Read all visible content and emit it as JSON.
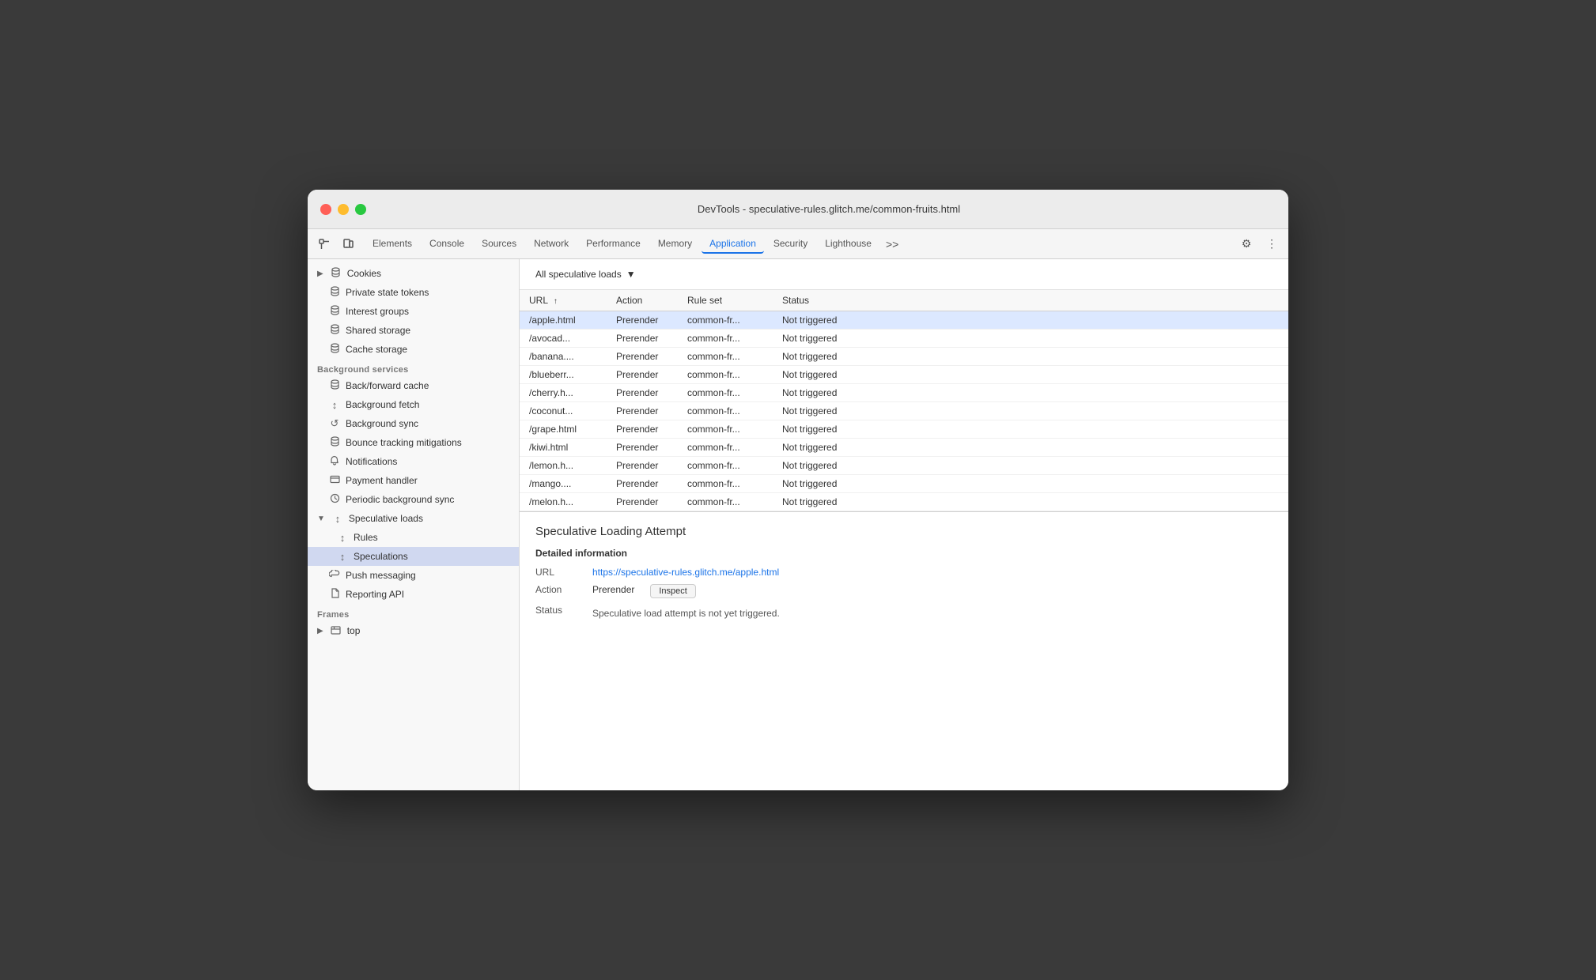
{
  "window": {
    "title": "DevTools - speculative-rules.glitch.me/common-fruits.html"
  },
  "tabs": {
    "items": [
      {
        "label": "Elements",
        "active": false
      },
      {
        "label": "Console",
        "active": false
      },
      {
        "label": "Sources",
        "active": false
      },
      {
        "label": "Network",
        "active": false
      },
      {
        "label": "Performance",
        "active": false
      },
      {
        "label": "Memory",
        "active": false
      },
      {
        "label": "Application",
        "active": true
      },
      {
        "label": "Security",
        "active": false
      },
      {
        "label": "Lighthouse",
        "active": false
      }
    ],
    "more_label": ">>",
    "settings_icon": "⚙",
    "kebab_icon": "⋮"
  },
  "sidebar": {
    "sections": [
      {
        "items": [
          {
            "label": "Cookies",
            "icon": "▶",
            "icon_type": "chevron",
            "has_db": true,
            "indent": 0
          },
          {
            "label": "Private state tokens",
            "icon": "",
            "has_db": true,
            "indent": 0
          },
          {
            "label": "Interest groups",
            "icon": "",
            "has_db": true,
            "indent": 0
          },
          {
            "label": "Shared storage",
            "icon": "",
            "has_db": true,
            "indent": 0
          },
          {
            "label": "Cache storage",
            "icon": "",
            "has_db": true,
            "indent": 0
          }
        ]
      },
      {
        "title": "Background services",
        "items": [
          {
            "label": "Back/forward cache",
            "icon": "",
            "has_db": true,
            "indent": 0
          },
          {
            "label": "Background fetch",
            "icon": "↕",
            "indent": 0
          },
          {
            "label": "Background sync",
            "icon": "↺",
            "indent": 0
          },
          {
            "label": "Bounce tracking mitigations",
            "icon": "",
            "has_db": true,
            "indent": 0
          },
          {
            "label": "Notifications",
            "icon": "🔔",
            "indent": 0
          },
          {
            "label": "Payment handler",
            "icon": "💳",
            "indent": 0
          },
          {
            "label": "Periodic background sync",
            "icon": "⏰",
            "indent": 0
          },
          {
            "label": "Speculative loads",
            "icon": "↕",
            "is_open": true,
            "indent": 0
          },
          {
            "label": "Rules",
            "icon": "↕",
            "indent": 1
          },
          {
            "label": "Speculations",
            "icon": "↕",
            "indent": 1,
            "active": true
          },
          {
            "label": "Push messaging",
            "icon": "☁",
            "indent": 0
          },
          {
            "label": "Reporting API",
            "icon": "📄",
            "indent": 0
          }
        ]
      },
      {
        "title": "Frames",
        "items": [
          {
            "label": "top",
            "icon": "▶",
            "icon_type": "chevron",
            "has_frame": true,
            "indent": 0
          }
        ]
      }
    ]
  },
  "filter": {
    "dropdown_label": "All speculative loads",
    "dropdown_icon": "▼"
  },
  "table": {
    "columns": [
      {
        "label": "URL",
        "sort": "↑"
      },
      {
        "label": "Action"
      },
      {
        "label": "Rule set"
      },
      {
        "label": "Status"
      }
    ],
    "rows": [
      {
        "url": "/apple.html",
        "action": "Prerender",
        "ruleset": "common-fr...",
        "status": "Not triggered",
        "selected": true
      },
      {
        "url": "/avocad...",
        "action": "Prerender",
        "ruleset": "common-fr...",
        "status": "Not triggered",
        "selected": false
      },
      {
        "url": "/banana....",
        "action": "Prerender",
        "ruleset": "common-fr...",
        "status": "Not triggered",
        "selected": false
      },
      {
        "url": "/blueberr...",
        "action": "Prerender",
        "ruleset": "common-fr...",
        "status": "Not triggered",
        "selected": false
      },
      {
        "url": "/cherry.h...",
        "action": "Prerender",
        "ruleset": "common-fr...",
        "status": "Not triggered",
        "selected": false
      },
      {
        "url": "/coconut...",
        "action": "Prerender",
        "ruleset": "common-fr...",
        "status": "Not triggered",
        "selected": false
      },
      {
        "url": "/grape.html",
        "action": "Prerender",
        "ruleset": "common-fr...",
        "status": "Not triggered",
        "selected": false
      },
      {
        "url": "/kiwi.html",
        "action": "Prerender",
        "ruleset": "common-fr...",
        "status": "Not triggered",
        "selected": false
      },
      {
        "url": "/lemon.h...",
        "action": "Prerender",
        "ruleset": "common-fr...",
        "status": "Not triggered",
        "selected": false
      },
      {
        "url": "/mango....",
        "action": "Prerender",
        "ruleset": "common-fr...",
        "status": "Not triggered",
        "selected": false
      },
      {
        "url": "/melon.h...",
        "action": "Prerender",
        "ruleset": "common-fr...",
        "status": "Not triggered",
        "selected": false
      }
    ]
  },
  "detail": {
    "title": "Speculative Loading Attempt",
    "section_title": "Detailed information",
    "url_label": "URL",
    "url_value": "https://speculative-rules.glitch.me/apple.html",
    "action_label": "Action",
    "action_value": "Prerender",
    "inspect_label": "Inspect",
    "status_label": "Status",
    "status_value": "Speculative load attempt is not yet triggered."
  }
}
